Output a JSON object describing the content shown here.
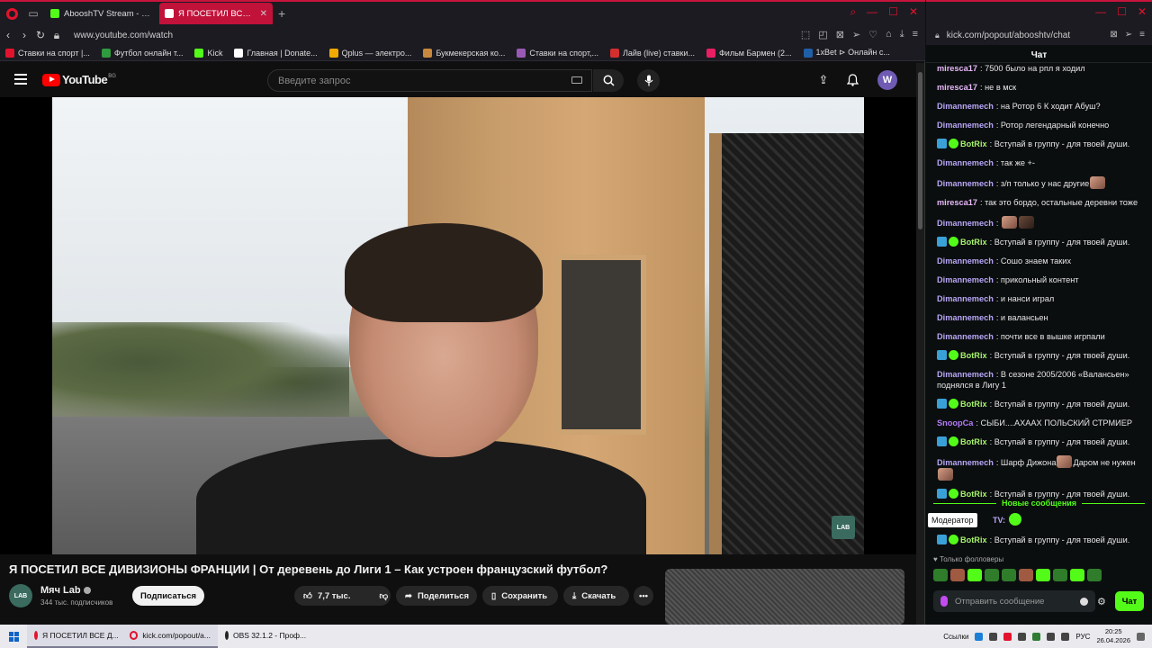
{
  "left_browser": {
    "tabs": [
      {
        "title": "AbooshTV Stream - Watch",
        "favicon_color": "#53fc18"
      },
      {
        "title": "Я ПОСЕТИЛ ВСЕ ДИВ",
        "favicon_color": "#ff0000",
        "active": true
      }
    ],
    "url": "www.youtube.com/watch",
    "bookmarks": [
      {
        "label": "Ставки на спорт |...",
        "color": "#e3132d"
      },
      {
        "label": "Футбол онлайн т...",
        "color": "#2f9a3f"
      },
      {
        "label": "Kick",
        "color": "#53fc18"
      },
      {
        "label": "Главная | Donate...",
        "color": "#ffffff"
      },
      {
        "label": "Qplus — электро...",
        "color": "#f2a900"
      },
      {
        "label": "Букмекерская ко...",
        "color": "#c8893f"
      },
      {
        "label": "Ставки на спорт,...",
        "color": "#9b59b6"
      },
      {
        "label": "Лайв (live) ставки...",
        "color": "#d32f2f"
      },
      {
        "label": "Фильм Бармен (2...",
        "color": "#e91e63"
      },
      {
        "label": "1xBet ⊳ Онлайн с...",
        "color": "#1f5fa8"
      }
    ]
  },
  "youtube": {
    "logo_text": "YouTube",
    "region": "BG",
    "search_placeholder": "Введите запрос",
    "avatar_letter": "W",
    "video_title": "Я ПОСЕТИЛ ВСЕ ДИВИЗИОНЫ ФРАНЦИИ | От деревень до Лиги 1 – Как устроен французский футбол?",
    "watermark_text": "LAB",
    "channel": {
      "name": "Мяч Lab",
      "subscribers": "344 тыс. подписчиков",
      "avatar_text": "LAB"
    },
    "actions": {
      "subscribe": "Подписаться",
      "likes": "7,7 тыс.",
      "share": "Поделиться",
      "save": "Сохранить",
      "download": "Скачать"
    }
  },
  "kick_chat": {
    "url": "kick.com/popout/abooshtv/chat",
    "title": "Чат",
    "messages": [
      {
        "user": "miresca17",
        "text": "7500 было на рпл я ходил",
        "color": "c1"
      },
      {
        "user": "miresca17",
        "text": "не в мск",
        "color": "c1"
      },
      {
        "user": "Dimannemech",
        "text": "на Ротор 6 К ходит Абуш?",
        "color": "c2"
      },
      {
        "user": "Dimannemech",
        "text": "Ротор легендарный конечно",
        "color": "c2"
      },
      {
        "user": "BotRix",
        "text": "Вступай в группу - для твоей души.",
        "color": "c3",
        "bot": true
      },
      {
        "user": "Dimannemech",
        "text": "так же +-",
        "color": "c2"
      },
      {
        "user": "Dimannemech",
        "text": "з/п только у нас другие",
        "color": "c2",
        "emote": true
      },
      {
        "user": "miresca17",
        "text": "так это бордо, остальные деревни тоже",
        "color": "c1"
      },
      {
        "user": "Dimannemech",
        "text": "",
        "color": "c2",
        "emote": true,
        "emote2": true
      },
      {
        "user": "BotRix",
        "text": "Вступай в группу - для твоей души.",
        "color": "c3",
        "bot": true
      },
      {
        "user": "Dimannemech",
        "text": "Сошо знаем таких",
        "color": "c2"
      },
      {
        "user": "Dimannemech",
        "text": "прикольный контент",
        "color": "c2"
      },
      {
        "user": "Dimannemech",
        "text": "и нанси играл",
        "color": "c2"
      },
      {
        "user": "Dimannemech",
        "text": "и валансьен",
        "color": "c2"
      },
      {
        "user": "Dimannemech",
        "text": "почти все в вышке игрпали",
        "color": "c2"
      },
      {
        "user": "BotRix",
        "text": "Вступай в группу - для твоей души.",
        "color": "c3",
        "bot": true
      },
      {
        "user": "Dimannemech",
        "text": "В сезоне 2005/2006 «Валансьен» поднялся в Лигу 1",
        "color": "c2"
      },
      {
        "user": "BotRix",
        "text": "Вступай в группу - для твоей души.",
        "color": "c3",
        "bot": true
      },
      {
        "user": "SnoopCa",
        "text": "СЫБИ....АХААХ ПОЛЬСКИЙ СТРМИЕР",
        "color": "c4"
      },
      {
        "user": "BotRix",
        "text": "Вступай в группу - для твоей души.",
        "color": "c3",
        "bot": true
      },
      {
        "user": "Dimannemech",
        "text": "Шарф Дижона",
        "text2": "Даром не нужен",
        "color": "c2",
        "emote": true,
        "emote_after": true
      },
      {
        "user": "BotRix",
        "text": "Вступай в группу - для твоей души.",
        "color": "c3",
        "bot": true
      }
    ],
    "new_messages_label": "Новые сообщения",
    "tooltip": "Модератор",
    "tooltip_user_tail": "TV:",
    "last_bot_user": "BotRix",
    "last_bot_text": "Вступай в группу - для твоей души.",
    "followers_only": "Только фолловеры",
    "input_placeholder": "Отправить сообщение",
    "send_label": "Чат"
  },
  "taskbar": {
    "items": [
      {
        "label": "Я ПОСЕТИЛ ВСЕ Д...",
        "color": "#e3132d",
        "active": true
      },
      {
        "label": "kick.com/popout/a...",
        "color": "#e3132d",
        "active": true
      },
      {
        "label": "OBS 32.1.2 - Проф...",
        "color": "#222222",
        "active": false
      }
    ],
    "links_label": "Ссылки",
    "lang": "РУС",
    "time": "20:25",
    "date": "26.04.2026"
  }
}
